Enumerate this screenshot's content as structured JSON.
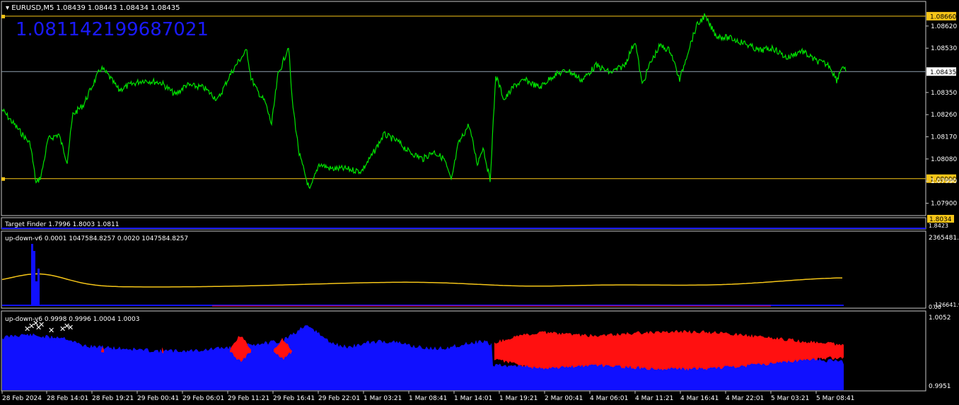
{
  "main": {
    "header": "EURUSD,M5  1.08439 1.08443 1.08434 1.08435",
    "big_value": "1.081142199687021",
    "axis": {
      "min": 1.0785,
      "max": 1.0872
    },
    "ticks": [
      "1.08620",
      "1.08530",
      "1.08350",
      "1.08260",
      "1.08170",
      "1.08080",
      "1.07990",
      "1.07900"
    ],
    "tick_values": [
      1.0862,
      1.0853,
      1.0835,
      1.0826,
      1.0817,
      1.0808,
      1.0799,
      1.079
    ],
    "hlines": [
      {
        "label": "1.08660",
        "value": 1.0866,
        "color": "#f5c518",
        "badge": true
      },
      {
        "label": "1.08000",
        "value": 1.08,
        "color": "#f5c518",
        "badge": true
      },
      {
        "label": "1.08435",
        "value": 1.08435,
        "color": "#8fa0b0",
        "badge": false
      }
    ]
  },
  "target": {
    "label": "Target Finder 1.7996 1.8003 1.0811",
    "ticks": [
      "1.8034",
      "1.8423"
    ]
  },
  "ind1": {
    "label": "up-down-v6 0.0001 1047584.8257 0.0020 1047584.8257",
    "ticks": [
      "2365481.9",
      "0.00",
      "-126641.9"
    ]
  },
  "ind2": {
    "label": "up-down-v6 0.9998 0.9996 1.0004 1.0003",
    "ticks": [
      "1.0052",
      "0.9951"
    ]
  },
  "xaxis": [
    "28 Feb 2024",
    "28 Feb 14:01",
    "28 Feb 19:21",
    "29 Feb 00:41",
    "29 Feb 06:01",
    "29 Feb 11:21",
    "29 Feb 16:41",
    "29 Feb 22:01",
    "1 Mar 03:21",
    "1 Mar 08:41",
    "1 Mar 14:01",
    "1 Mar 19:21",
    "2 Mar 00:41",
    "4 Mar 06:01",
    "4 Mar 11:21",
    "4 Mar 16:41",
    "4 Mar 22:01",
    "5 Mar 03:21",
    "5 Mar 08:41"
  ],
  "chart_data": {
    "type": "line",
    "name": "EURUSD,M5",
    "x": [
      "28 Feb 2024",
      "28 Feb 14:01",
      "28 Feb 19:21",
      "29 Feb 00:41",
      "29 Feb 06:01",
      "29 Feb 11:21",
      "29 Feb 16:41",
      "29 Feb 22:01",
      "1 Mar 03:21",
      "1 Mar 08:41",
      "1 Mar 14:01",
      "1 Mar 19:21",
      "2 Mar 00:41",
      "4 Mar 06:01",
      "4 Mar 11:21",
      "4 Mar 16:41",
      "4 Mar 22:01",
      "5 Mar 03:21",
      "5 Mar 08:41"
    ],
    "y": [
      1.0828,
      1.081,
      1.0842,
      1.0838,
      1.0834,
      1.0852,
      1.0812,
      1.0806,
      1.0811,
      1.0812,
      1.0803,
      1.084,
      1.084,
      1.0848,
      1.085,
      1.0863,
      1.0857,
      1.085,
      1.0844
    ],
    "points": [
      [
        0,
        1.0828
      ],
      [
        40,
        1.0814
      ],
      [
        48,
        1.0798
      ],
      [
        55,
        1.0801
      ],
      [
        65,
        1.0816
      ],
      [
        80,
        1.0818
      ],
      [
        92,
        1.0807
      ],
      [
        100,
        1.0826
      ],
      [
        115,
        1.083
      ],
      [
        128,
        1.0838
      ],
      [
        140,
        1.0845
      ],
      [
        150,
        1.0842
      ],
      [
        165,
        1.0836
      ],
      [
        180,
        1.0838
      ],
      [
        200,
        1.084
      ],
      [
        225,
        1.0839
      ],
      [
        245,
        1.0834
      ],
      [
        260,
        1.0838
      ],
      [
        285,
        1.0837
      ],
      [
        305,
        1.0832
      ],
      [
        322,
        1.0842
      ],
      [
        335,
        1.0848
      ],
      [
        346,
        1.0852
      ],
      [
        352,
        1.0841
      ],
      [
        360,
        1.0836
      ],
      [
        372,
        1.0831
      ],
      [
        381,
        1.0822
      ],
      [
        390,
        1.0842
      ],
      [
        398,
        1.0848
      ],
      [
        405,
        1.0854
      ],
      [
        410,
        1.0832
      ],
      [
        420,
        1.081
      ],
      [
        435,
        1.0795
      ],
      [
        448,
        1.0806
      ],
      [
        465,
        1.0804
      ],
      [
        485,
        1.0804
      ],
      [
        508,
        1.0803
      ],
      [
        522,
        1.0809
      ],
      [
        540,
        1.0818
      ],
      [
        560,
        1.0815
      ],
      [
        575,
        1.0811
      ],
      [
        595,
        1.0808
      ],
      [
        610,
        1.0811
      ],
      [
        625,
        1.0808
      ],
      [
        635,
        1.0799
      ],
      [
        645,
        1.0814
      ],
      [
        660,
        1.0822
      ],
      [
        672,
        1.0806
      ],
      [
        680,
        1.0813
      ],
      [
        690,
        1.0799
      ],
      [
        698,
        1.0842
      ],
      [
        710,
        1.0832
      ],
      [
        725,
        1.0838
      ],
      [
        740,
        1.084
      ],
      [
        760,
        1.0837
      ],
      [
        780,
        1.0842
      ],
      [
        800,
        1.0844
      ],
      [
        820,
        1.084
      ],
      [
        840,
        1.0846
      ],
      [
        860,
        1.0843
      ],
      [
        880,
        1.0846
      ],
      [
        895,
        1.0856
      ],
      [
        905,
        1.0838
      ],
      [
        915,
        1.0846
      ],
      [
        930,
        1.0854
      ],
      [
        945,
        1.0852
      ],
      [
        958,
        1.084
      ],
      [
        970,
        1.0852
      ],
      [
        982,
        1.0862
      ],
      [
        993,
        1.0866
      ],
      [
        1010,
        1.0858
      ],
      [
        1030,
        1.0857
      ],
      [
        1050,
        1.0855
      ],
      [
        1070,
        1.0852
      ],
      [
        1090,
        1.0853
      ],
      [
        1110,
        1.0849
      ],
      [
        1130,
        1.0852
      ],
      [
        1150,
        1.0848
      ],
      [
        1170,
        1.0846
      ],
      [
        1180,
        1.084
      ],
      [
        1188,
        1.0846
      ],
      [
        1193,
        1.08435
      ]
    ]
  },
  "colors": {
    "price": "#00e400",
    "yellow": "#f5c518",
    "blue": "#1010ff",
    "red": "#ff1010",
    "bg": "#000000",
    "grid": "#8fa0b0"
  }
}
